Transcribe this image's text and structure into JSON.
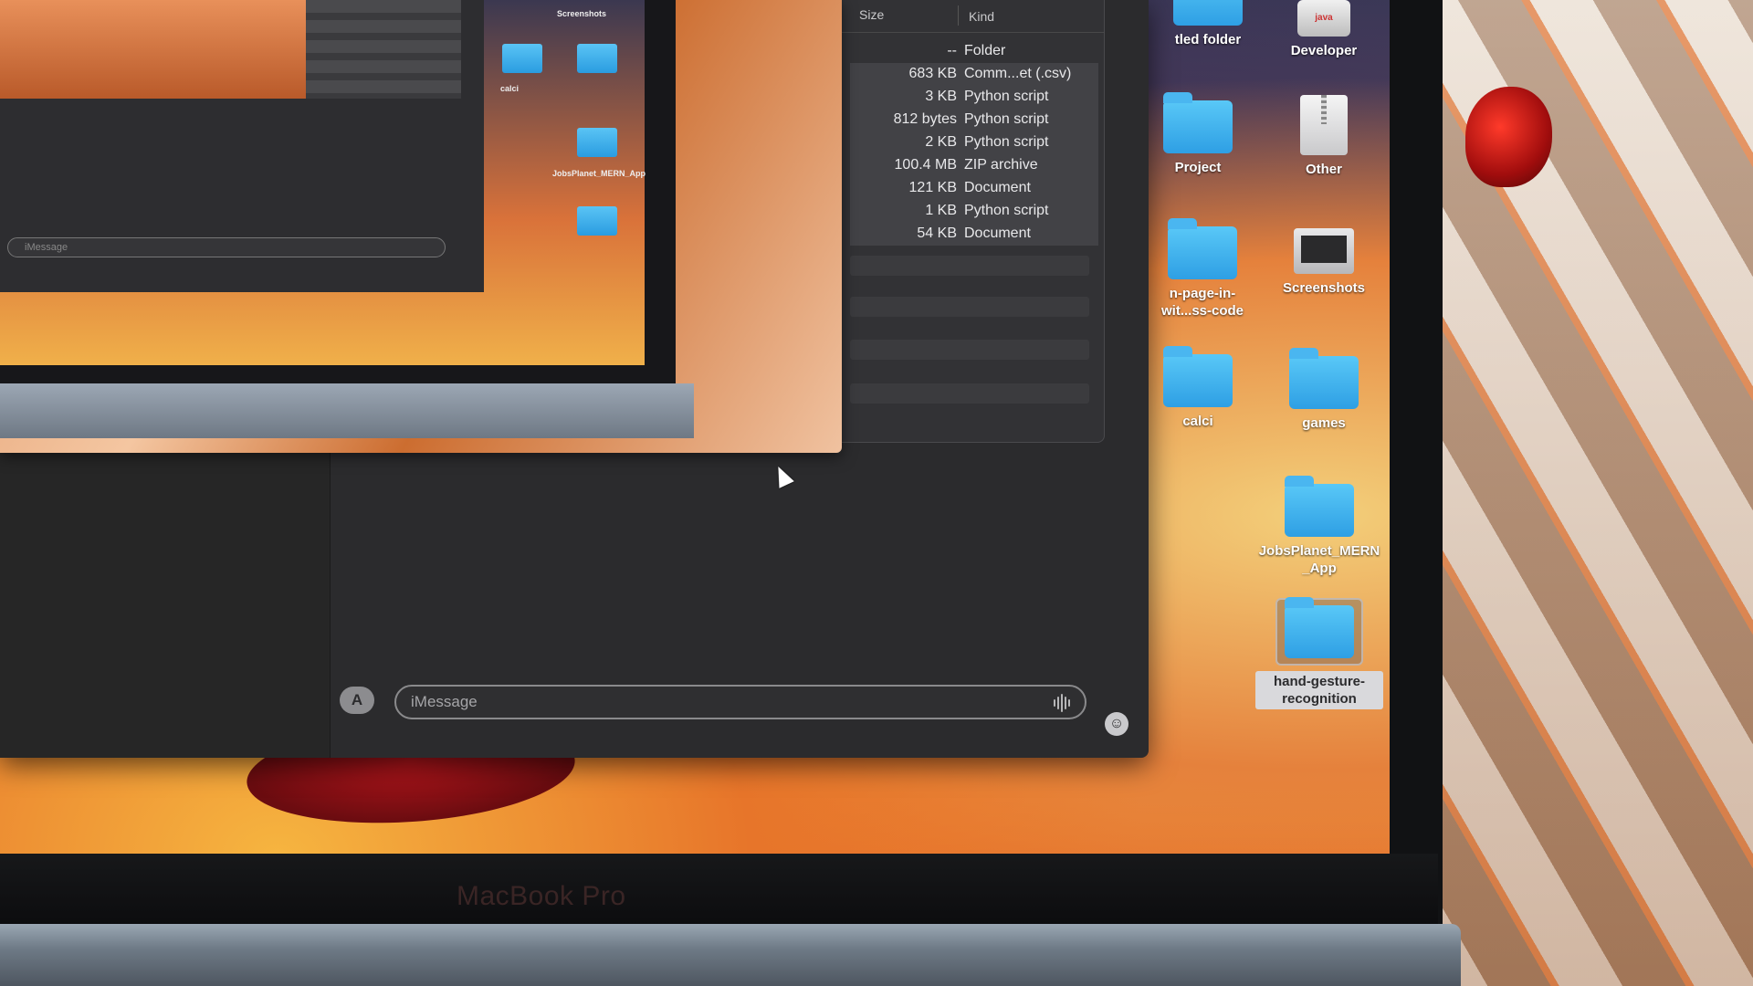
{
  "device": {
    "brand_label": "MacBook Pro"
  },
  "messages": {
    "input_placeholder": "iMessage",
    "appstore_icon": "A",
    "emoji_icon": "☺"
  },
  "preview": {
    "input_placeholder": "iMessage",
    "folders": [
      "calci",
      "JobsPlanet_MERN_App",
      "Screenshots"
    ]
  },
  "finder": {
    "columns": {
      "size": "Size",
      "kind": "Kind"
    },
    "rows": [
      {
        "size": "--",
        "kind": "Folder"
      },
      {
        "size": "683 KB",
        "kind": "Comm...et (.csv)"
      },
      {
        "size": "3 KB",
        "kind": "Python script"
      },
      {
        "size": "812 bytes",
        "kind": "Python script"
      },
      {
        "size": "2 KB",
        "kind": "Python script"
      },
      {
        "size": "100.4 MB",
        "kind": "ZIP archive"
      },
      {
        "size": "121 KB",
        "kind": "Document"
      },
      {
        "size": "1 KB",
        "kind": "Python script"
      },
      {
        "size": "54 KB",
        "kind": "Document"
      }
    ]
  },
  "desktop": {
    "items": [
      {
        "label": "tled folder",
        "icon": "folder-icon"
      },
      {
        "label": "Developer",
        "icon": "java-icon"
      },
      {
        "label": "Project",
        "icon": "folder-icon"
      },
      {
        "label": "Other",
        "icon": "zip-icon"
      },
      {
        "label": "n-page-in-\nwit...ss-code",
        "icon": "folder-icon"
      },
      {
        "label": "Screenshots",
        "icon": "screenshots-icon"
      },
      {
        "label": "calci",
        "icon": "folder-icon"
      },
      {
        "label": "games",
        "icon": "folder-icon"
      },
      {
        "label": "JobsPlanet_MERN\n_App",
        "icon": "folder-icon"
      },
      {
        "label": "hand-gesture-\nrecognition",
        "icon": "folder-icon",
        "selected": true
      }
    ],
    "java_badge": "java"
  }
}
